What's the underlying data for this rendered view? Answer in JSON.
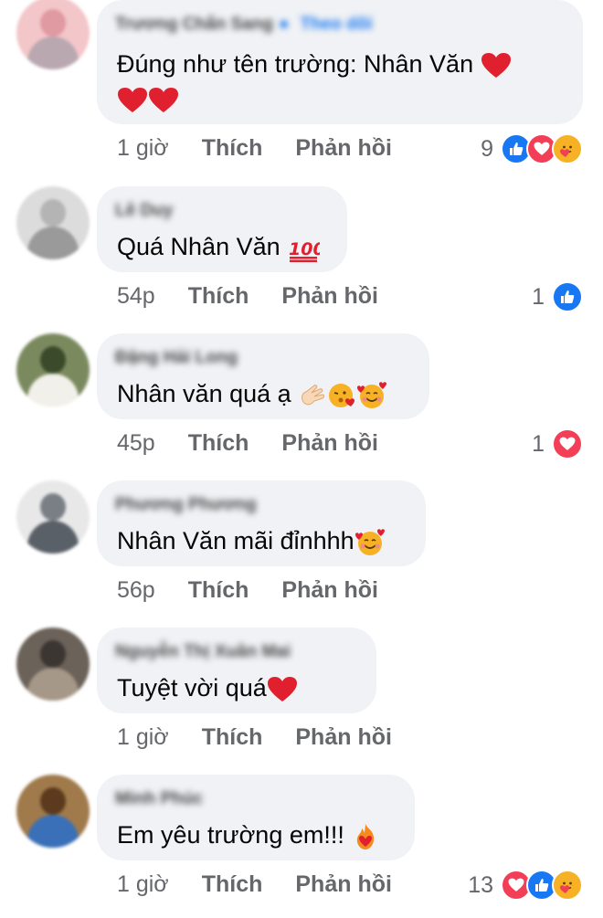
{
  "comments": [
    {
      "author": "Trương Chấn Sang",
      "verified": true,
      "follow_label": "Theo dõi",
      "text": "Đúng như tên trường: Nhân Văn",
      "text_line2": "",
      "time": "1 giờ",
      "like_label": "Thích",
      "reply_label": "Phản hồi",
      "reaction_count": "9",
      "reactions": [
        "like",
        "love",
        "care"
      ],
      "avatar_colors": [
        "#f3c6c9",
        "#e09aa1",
        "#b9a8b0"
      ]
    },
    {
      "author": "Lê Duy",
      "text": "Quá Nhân Văn",
      "time": "54p",
      "like_label": "Thích",
      "reply_label": "Phản hồi",
      "reaction_count": "1",
      "reactions": [
        "like"
      ],
      "avatar_colors": [
        "#dcdcdc",
        "#b4b4b4",
        "#9a9a9a"
      ]
    },
    {
      "author": "Đặng Hải Long",
      "text": "Nhân văn quá ạ",
      "time": "45p",
      "like_label": "Thích",
      "reply_label": "Phản hồi",
      "reaction_count": "1",
      "reactions": [
        "love"
      ],
      "avatar_colors": [
        "#7b8a5e",
        "#3a4a2a",
        "#f2f0ea"
      ]
    },
    {
      "author": "Phương Phương",
      "text": "Nhân Văn mãi đỉnhhh",
      "time": "56p",
      "like_label": "Thích",
      "reply_label": "Phản hồi",
      "reaction_count": "",
      "reactions": [],
      "avatar_colors": [
        "#e8e8e8",
        "#7a7f86",
        "#5a6068"
      ]
    },
    {
      "author": "Nguyễn Thị Xuân Mai",
      "text": "Tuyệt vời quá",
      "time": "1 giờ",
      "like_label": "Thích",
      "reply_label": "Phản hồi",
      "reaction_count": "",
      "reactions": [],
      "avatar_colors": [
        "#6b6259",
        "#3b3631",
        "#a69888"
      ]
    },
    {
      "author": "Minh Phúc",
      "text": "Em yêu trường em!!!",
      "time": "1 giờ",
      "like_label": "Thích",
      "reply_label": "Phản hồi",
      "reaction_count": "13",
      "reactions": [
        "love",
        "like",
        "care"
      ],
      "avatar_colors": [
        "#a07a4a",
        "#5b3a1e",
        "#3a70b8"
      ]
    }
  ]
}
